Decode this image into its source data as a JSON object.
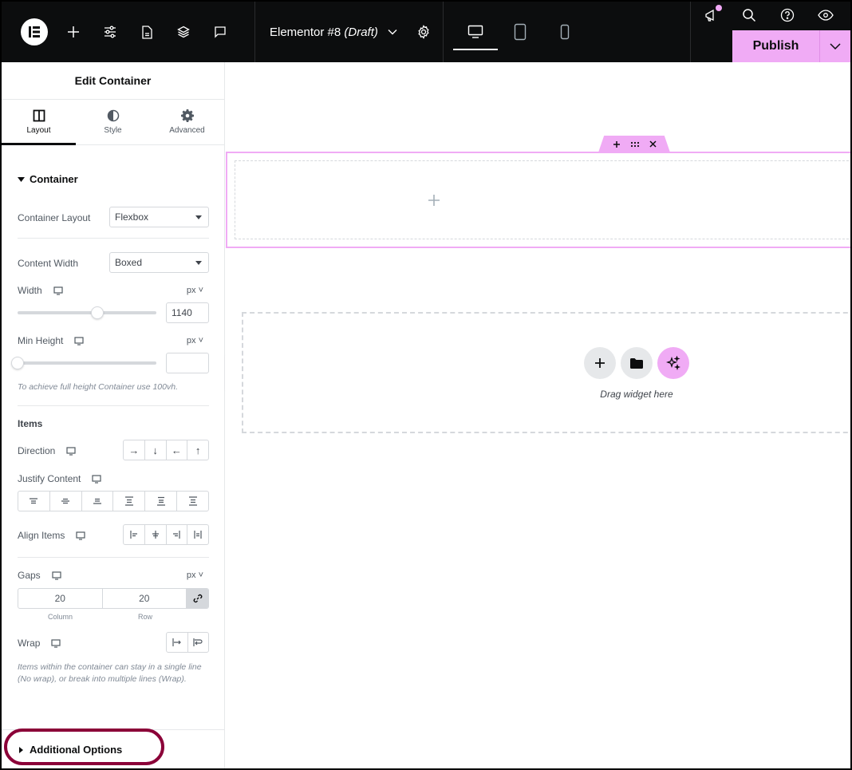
{
  "topbar": {
    "icons": [
      "elementor-logo-icon",
      "add-element-icon",
      "site-settings-icon",
      "page-icon",
      "structure-layers-icon",
      "comments-icon"
    ],
    "document": {
      "name": "Elementor #8",
      "status": "(Draft)"
    },
    "devices": [
      "desktop",
      "tablet",
      "mobile"
    ],
    "active_device": "desktop",
    "right_icons": [
      "whats-new-icon",
      "search-icon",
      "help-icon",
      "preview-icon"
    ],
    "publish_label": "Publish"
  },
  "panel": {
    "title": "Edit Container",
    "tabs": [
      {
        "label": "Layout",
        "active": true
      },
      {
        "label": "Style",
        "active": false
      },
      {
        "label": "Advanced",
        "active": false
      }
    ],
    "section": "Container",
    "container_layout": {
      "label": "Container Layout",
      "value": "Flexbox"
    },
    "content_width": {
      "label": "Content Width",
      "value": "Boxed"
    },
    "width": {
      "label": "Width",
      "unit": "px",
      "value": "1140",
      "slider_fraction": 0.58
    },
    "min_height": {
      "label": "Min Height",
      "unit": "px",
      "value": "",
      "slider_fraction": 0
    },
    "min_height_hint": "To achieve full height Container use 100vh.",
    "items_title": "Items",
    "direction": {
      "label": "Direction",
      "options": [
        "→",
        "↓",
        "←",
        "↑"
      ]
    },
    "justify_content": {
      "label": "Justify Content",
      "options": [
        "start",
        "center",
        "end",
        "space-between",
        "space-around",
        "space-evenly"
      ]
    },
    "align_items": {
      "label": "Align Items",
      "options": [
        "start",
        "center",
        "end",
        "stretch"
      ]
    },
    "gaps": {
      "label": "Gaps",
      "unit": "px",
      "column": "20",
      "row": "20",
      "column_label": "Column",
      "row_label": "Row"
    },
    "wrap": {
      "label": "Wrap",
      "options": [
        "no-wrap",
        "wrap"
      ]
    },
    "wrap_hint": "Items within the container can stay in a single line (No wrap), or break into multiple lines (Wrap).",
    "additional_options": "Additional Options"
  },
  "canvas": {
    "drop_text": "Drag widget here",
    "highlight_color": "#f0abf5"
  },
  "colors": {
    "accent": "#f0abf5",
    "annotation_ring": "#8b0038",
    "topbar_bg": "#0c0d0e"
  }
}
